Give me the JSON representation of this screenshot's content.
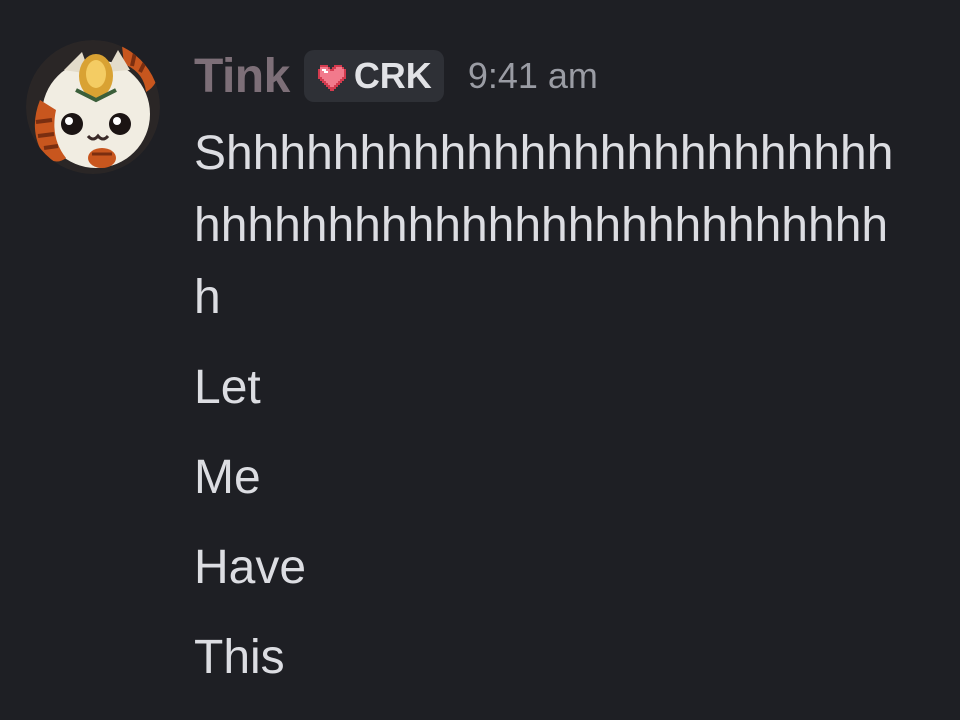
{
  "message": {
    "author": {
      "name": "Tink",
      "avatar_icon": "cat-cookie-avatar-icon",
      "name_color": "#7d6f78"
    },
    "guild_tag": {
      "icon": "pixel-heart-icon",
      "label": "CRK"
    },
    "timestamp": "9:41 am",
    "lines": [
      "Shhhhhhhhhhhhhhhhhhhhhhhhhhhhhhhhhhhhhhhhhhhhhhhhhhhh",
      "Let",
      "Me",
      "Have",
      "This"
    ]
  },
  "colors": {
    "background": "#1e1f24",
    "text": "#dcdde2",
    "timestamp": "#9a9ca4",
    "tag_background": "#2e3036"
  }
}
